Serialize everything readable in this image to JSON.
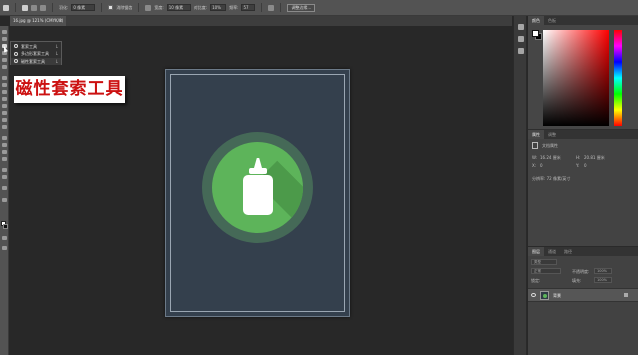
{
  "options_bar": {
    "feather_label": "羽化:",
    "feather_value": "0 像素",
    "antialias_label": "消除锯齿",
    "width_label": "宽度:",
    "width_value": "10 像素",
    "contrast_label": "对比度:",
    "contrast_value": "10%",
    "frequency_label": "频率:",
    "frequency_value": "57",
    "refine_edge_label": "调整边缘..."
  },
  "tabs": {
    "document_title": "16.jpg @ 121% (CMYK/8)",
    "close_glyph": "×"
  },
  "flyout": {
    "items": [
      {
        "label": "套索工具",
        "key": "L"
      },
      {
        "label": "多边形套索工具",
        "key": "L"
      },
      {
        "label": "磁性套索工具",
        "key": "L"
      }
    ]
  },
  "caption": {
    "text": "磁性套索工具"
  },
  "right_panels": {
    "color_tabs": [
      "颜色",
      "色板"
    ],
    "properties_tabs": [
      "属性",
      "调整"
    ],
    "doc_props_label": "文档属性",
    "w_label": "W:",
    "w_value": "16.24 厘米",
    "h_label": "H:",
    "h_value": "20.81 厘米",
    "x_label": "X:",
    "x_value": "0",
    "y_label": "Y:",
    "y_value": "0",
    "resolution": "分辨率: 72 像素/英寸",
    "layers_tabs": [
      "图层",
      "通道",
      "路径"
    ],
    "kind_label": "类型",
    "mode_label": "正常",
    "opacity_label": "不透明度:",
    "opacity_value": "100%",
    "lock_label": "锁定:",
    "fill_label": "填充:",
    "fill_value": "100%",
    "layer_name": "背景"
  },
  "colors": {
    "caption_text": "#cc1111",
    "canvas_bg": "#34404d",
    "circle_green": "#5db45a"
  },
  "icons": {
    "flyout_icon": "lasso-icon",
    "visibility": "eye-icon",
    "layer_lock": "lock-icon"
  }
}
